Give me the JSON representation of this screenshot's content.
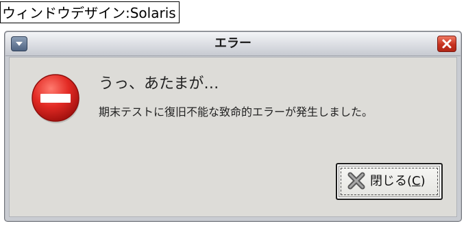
{
  "caption": {
    "text": "ウィンドウデザイン:Solaris"
  },
  "window": {
    "title": "エラー",
    "menu_icon": "chevron-down-icon",
    "close_icon": "close-icon",
    "accent_close": "#c73220",
    "accent_menu": "#4f6482"
  },
  "dialog": {
    "icon": "error-stop-icon",
    "icon_color": "#e02a24",
    "headline": "うっ、あたまが…",
    "message": "期末テストに復旧不能な致命的エラーが発生しました。",
    "button": {
      "icon": "x-icon",
      "label_prefix": "閉じる(",
      "mnemonic": "C",
      "label_suffix": ")"
    }
  }
}
